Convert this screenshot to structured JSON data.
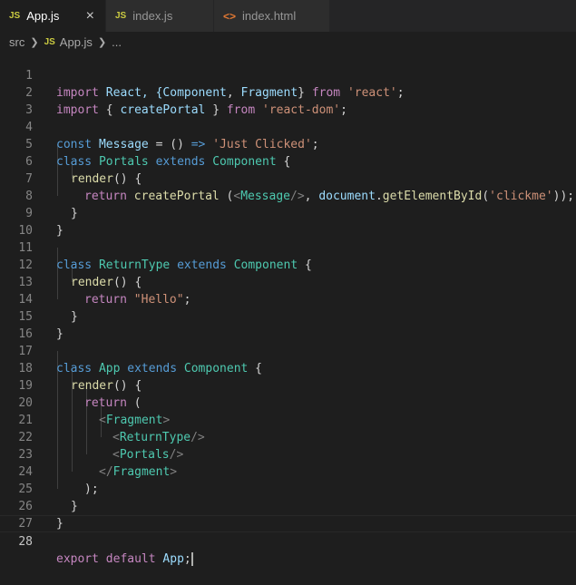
{
  "tabs": [
    {
      "icon": "JS",
      "label": "App.js",
      "close": "×"
    },
    {
      "icon": "JS",
      "label": "index.js"
    },
    {
      "icon": "<>",
      "label": "index.html"
    }
  ],
  "breadcrumb": {
    "folder": "src",
    "file_icon": "JS",
    "file": "App.js",
    "more": "..."
  },
  "line_numbers": [
    "1",
    "2",
    "3",
    "4",
    "5",
    "6",
    "7",
    "8",
    "9",
    "10",
    "11",
    "12",
    "13",
    "14",
    "15",
    "16",
    "17",
    "18",
    "19",
    "20",
    "21",
    "22",
    "23",
    "24",
    "25",
    "26",
    "27",
    "28"
  ],
  "code": {
    "l1": {
      "t1": "import",
      "t2": " React, {",
      "t3": "Component",
      "t4": ", ",
      "t5": "Fragment",
      "t6": "} ",
      "t7": "from",
      "t8": " ",
      "t9": "'react'",
      "t10": ";"
    },
    "l2": {
      "t1": "import",
      "t2": " { ",
      "t3": "createPortal",
      "t4": " } ",
      "t5": "from",
      "t6": " ",
      "t7": "'react-dom'",
      "t8": ";"
    },
    "l4": {
      "t1": "const",
      "t2": " ",
      "t3": "Message",
      "t4": " = () ",
      "t5": "=>",
      "t6": " ",
      "t7": "'Just Clicked'",
      "t8": ";"
    },
    "l5": {
      "t1": "class",
      "t2": " ",
      "t3": "Portals",
      "t4": " ",
      "t5": "extends",
      "t6": " ",
      "t7": "Component",
      "t8": " {"
    },
    "l6": {
      "t1": "render",
      "t2": "() {"
    },
    "l7": {
      "t1": "return",
      "t2": " ",
      "t3": "createPortal",
      "t4": " (",
      "t5": "<",
      "t6": "Message",
      "t7": "/>",
      "t8": ", ",
      "t9": "document",
      "t10": ".",
      "t11": "getElementById",
      "t12": "(",
      "t13": "'clickme'",
      "t14": "));"
    },
    "l8": {
      "t1": "}"
    },
    "l9": {
      "t1": "}"
    },
    "l11": {
      "t1": "class",
      "t2": " ",
      "t3": "ReturnType",
      "t4": " ",
      "t5": "extends",
      "t6": " ",
      "t7": "Component",
      "t8": " {"
    },
    "l12": {
      "t1": "render",
      "t2": "() {"
    },
    "l13": {
      "t1": "return",
      "t2": " ",
      "t3": "\"Hello\"",
      "t4": ";"
    },
    "l14": {
      "t1": "}"
    },
    "l15": {
      "t1": "}"
    },
    "l17": {
      "t1": "class",
      "t2": " ",
      "t3": "App",
      "t4": " ",
      "t5": "extends",
      "t6": " ",
      "t7": "Component",
      "t8": " {"
    },
    "l18": {
      "t1": "render",
      "t2": "() {"
    },
    "l19": {
      "t1": "return",
      "t2": " ("
    },
    "l20": {
      "t1": "<",
      "t2": "Fragment",
      "t3": ">"
    },
    "l21": {
      "t1": "<",
      "t2": "ReturnType",
      "t3": "/>"
    },
    "l22": {
      "t1": "<",
      "t2": "Portals",
      "t3": "/>"
    },
    "l23": {
      "t1": "</",
      "t2": "Fragment",
      "t3": ">"
    },
    "l24": {
      "t1": ");"
    },
    "l25": {
      "t1": "}"
    },
    "l26": {
      "t1": "}"
    },
    "l28": {
      "t1": "export",
      "t2": " ",
      "t3": "default",
      "t4": " ",
      "t5": "App",
      "t6": ";"
    }
  }
}
